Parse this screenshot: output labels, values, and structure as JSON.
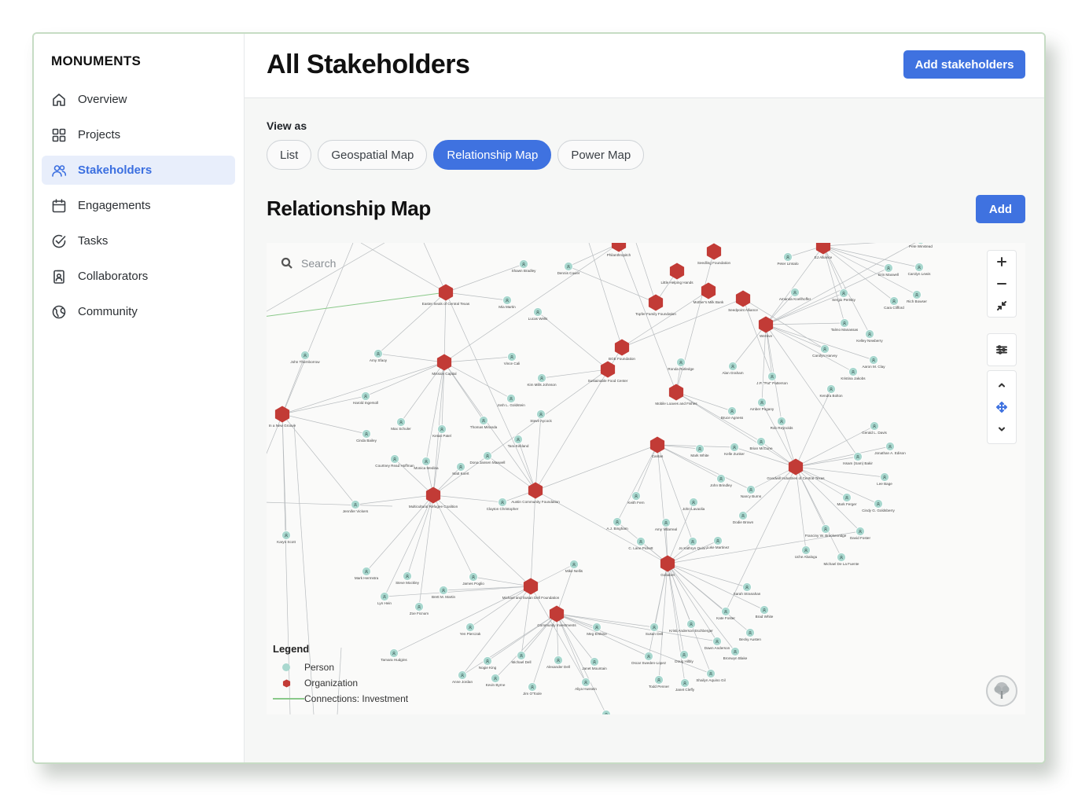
{
  "app": {
    "brand": "MONUMENTS"
  },
  "sidebar": {
    "items": [
      {
        "label": "Overview",
        "icon": "home-icon",
        "active": false
      },
      {
        "label": "Projects",
        "icon": "grid-icon",
        "active": false
      },
      {
        "label": "Stakeholders",
        "icon": "users-icon",
        "active": true
      },
      {
        "label": "Engagements",
        "icon": "calendar-icon",
        "active": false
      },
      {
        "label": "Tasks",
        "icon": "check-circle-icon",
        "active": false
      },
      {
        "label": "Collaborators",
        "icon": "id-card-icon",
        "active": false
      },
      {
        "label": "Community",
        "icon": "globe-icon",
        "active": false
      }
    ]
  },
  "header": {
    "title": "All Stakeholders",
    "add_button": "Add stakeholders"
  },
  "view_as": {
    "label": "View as",
    "tabs": [
      "List",
      "Geospatial Map",
      "Relationship Map",
      "Power Map"
    ],
    "active": "Relationship Map"
  },
  "section": {
    "title": "Relationship Map",
    "add_button": "Add"
  },
  "map": {
    "search_placeholder": "Search",
    "colors": {
      "person": "#a9d8cf",
      "organization": "#c23b36",
      "investment_edge": "#8ac98a",
      "edge": "#b8bcbf"
    },
    "legend": {
      "title": "Legend",
      "items": [
        {
          "label": "Person",
          "symbol": "dot"
        },
        {
          "label": "Organization",
          "symbol": "hexagon"
        },
        {
          "label": "Connections: Investment",
          "symbol": "line"
        }
      ]
    },
    "organizations": [
      "Philanthropitch",
      "Seedling Foundation",
      "EJ Alliance",
      "Easter Seals of Central Texas",
      "Little Helping Hands",
      "Mother's Milk Bank",
      "Seedpoint Alliance",
      "Topfer Family Foundation",
      "WeHive",
      "BGE Foundation",
      "Sustainable Food Center",
      "Mission Capital",
      "Mobile Loaves and Fishes",
      "In a New Groove",
      "Caritas",
      "Goodwill Industries of Central Texas",
      "Multicultural Refugee Coalition",
      "Austin Community Foundation",
      "Gobabet",
      "Michael and Susan Dell Foundation",
      "Community Investments"
    ],
    "people": [
      "Pete Winstead",
      "Peter Limtalo",
      "Shawn Bradley",
      "Dennis Cavier",
      "Mia Martin",
      "Lucas Wells",
      "Erin Maxwell",
      "Carolyn Lewis",
      "Amanda Koellhoffer",
      "Sergio Pertsky",
      "Cara Clifford",
      "Rich Bowser",
      "Talmo Manassas",
      "Kelley Newberry",
      "John Thornborrow",
      "Amy Sfaoy",
      "Vince Cali",
      "Ronda Rutledge",
      "Carolyn Harvey",
      "Aaron M. Clay",
      "Alan Graham",
      "J.P. \"Pat\" Patterson",
      "Kristina Jakobs",
      "Kim Mills Johnson",
      "Harold Ingersoll",
      "Josh L. Goldstein",
      "Kendra Bolton",
      "Amber Pogany",
      "Steve Aycock",
      "Bruce Agness",
      "Rob Reynolds",
      "Max Schuler",
      "Thomas Miranda",
      "Ketan Patel",
      "Cinda Bailey",
      "Tara Kirkland",
      "Brian McCune",
      "Gerald L. Davis",
      "Mark White",
      "Kelle Zunker",
      "Jonathan A. Edison",
      "Courtney Read Hoffman",
      "Monica Medina",
      "Dona Jansen Maxwell",
      "Matt Koert",
      "Issam (Sam) Bakir",
      "Lee Bage",
      "John Brindley",
      "Nancy Burns",
      "Keith Fern",
      "John Lavaolia",
      "Jennifer Vickers",
      "Mark Ferger",
      "Cindy G. Goldsberry",
      "Clayton Christopher",
      "Dodie Brown",
      "Amy Villarreal",
      "A.J. Bingham",
      "Luke Martinez",
      "Franciny W. Breckenridge",
      "David Foster",
      "Karyn Scott",
      "C. Lane Pickett",
      "Jo Kathryn Quinn",
      "Uche Abalogu",
      "Michael De La Fuente",
      "Mike Nellis",
      "Mark Hermstra",
      "Steve Mockley",
      "James Poglio",
      "Brett M. Martin",
      "Sarah Stranahan",
      "Lyn Hein",
      "Zoe Ficnum",
      "Brad White",
      "Kate Foster",
      "Yen Pierczak",
      "Meg Erskine",
      "Susan Dell",
      "Kristi Anderson Eschberger",
      "Becky Austen",
      "Dawn Anderson",
      "Tamara Hudgins",
      "Nogie King",
      "Michael Dell",
      "Alexander Dell",
      "Janet Mountain",
      "Oscar Sweden-Lopez",
      "Doug Hilbly",
      "Bronwyn Blake",
      "Anne Jordan",
      "Kevin Byrne",
      "Jim O'Toole",
      "Aliya Hussein",
      "Todd Penner",
      "Janet Cleffy",
      "Shailyn Aquino Gil",
      "Julie Sherman",
      "Joe Sardecho"
    ]
  }
}
